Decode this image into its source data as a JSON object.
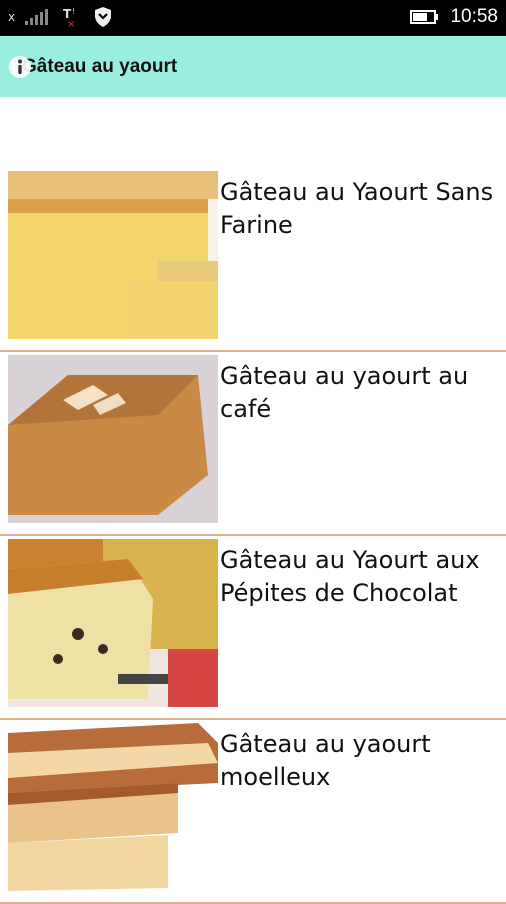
{
  "status_bar": {
    "time": "10:58",
    "icons": [
      "x-indicator-icon",
      "signal-icon",
      "network-error-icon",
      "shield-icon",
      "battery-icon"
    ]
  },
  "app_bar": {
    "title": "Gâteau au yaourt",
    "icon": "info-icon",
    "background": "#9aeee0"
  },
  "recipes": [
    {
      "title": "Gâteau au Yaourt Sans Farine",
      "image": "cake-photo"
    },
    {
      "title": "Gâteau au yaourt au café",
      "image": "cake-photo"
    },
    {
      "title": "Gâteau au Yaourt aux Pépites de Chocolat",
      "image": "cake-photo"
    },
    {
      "title": "Gâteau au yaourt moelleux",
      "image": "cake-photo"
    }
  ],
  "colors": {
    "divider": "#e0b38c"
  }
}
